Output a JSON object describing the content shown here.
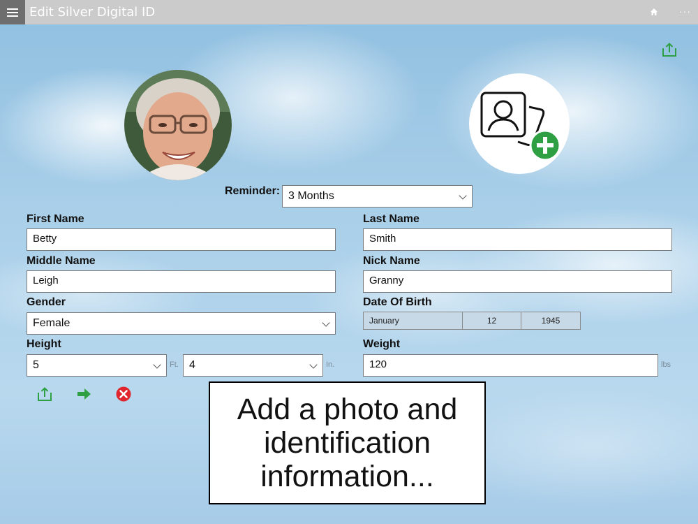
{
  "titlebar": {
    "title": "Edit Silver Digital ID",
    "menu_icon": "hamburger-icon",
    "home_icon": "home-icon",
    "more_label": "···"
  },
  "reminder": {
    "label": "Reminder:",
    "value": "3 Months"
  },
  "form": {
    "first_name": {
      "label": "First Name",
      "value": "Betty"
    },
    "last_name": {
      "label": "Last Name",
      "value": "Smith"
    },
    "middle_name": {
      "label": "Middle Name",
      "value": "Leigh"
    },
    "nick_name": {
      "label": "Nick Name",
      "value": "Granny"
    },
    "gender": {
      "label": "Gender",
      "value": "Female"
    },
    "date_of_birth": {
      "label": "Date Of Birth",
      "month": "January",
      "day": "12",
      "year": "1945"
    },
    "height": {
      "label": "Height",
      "feet": "5",
      "feet_unit": "Ft.",
      "inches": "4",
      "inches_unit": "In."
    },
    "weight": {
      "label": "Weight",
      "value": "120",
      "unit": "lbs"
    }
  },
  "actions": {
    "share_icon": "share-icon",
    "next_icon": "arrow-right-icon",
    "cancel_icon": "close-circle-icon"
  },
  "caption": {
    "text": "Add a photo and identification information..."
  },
  "colors": {
    "titlebar_bg": "#cbcbcb",
    "menu_bg": "#6e6e6e",
    "accent_green": "#2ea043",
    "cancel_red": "#e0262c"
  }
}
